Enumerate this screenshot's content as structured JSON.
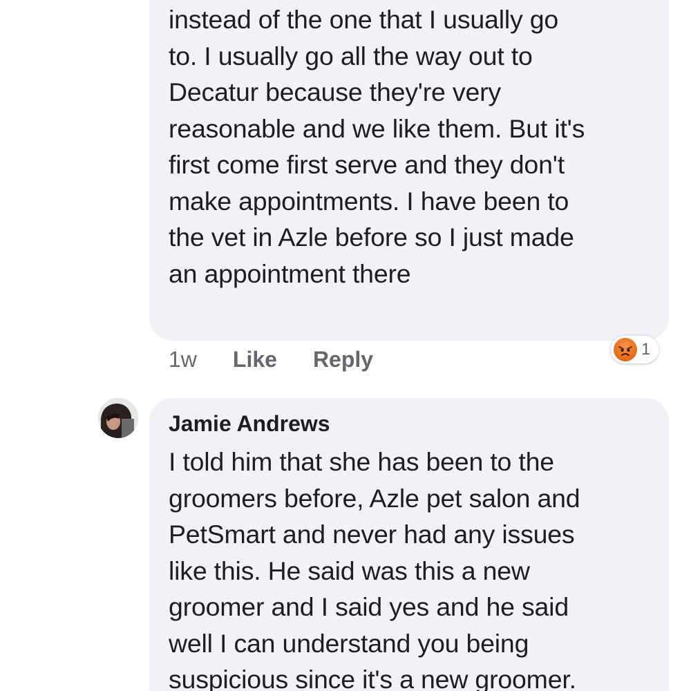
{
  "comment1": {
    "lines": [
      "instead of the one that I usually go",
      "to. I usually go all the way out to",
      "Decatur because they're very",
      "reasonable and we like them. But it's",
      "first come first serve and they don't",
      "make appointments. I have been to",
      "the vet in Azle before so I just made",
      "an appointment there"
    ],
    "time": "1w",
    "like_label": "Like",
    "reply_label": "Reply",
    "reaction": {
      "icon": "angry-reaction-icon",
      "count": "1",
      "color": "#e9711c"
    }
  },
  "comment2": {
    "author": "Jamie Andrews",
    "lines": [
      "I told him that she has been to the",
      "groomers before, Azle pet salon and",
      "PetSmart and never had any issues",
      "like this. He said was this a new",
      "groomer and I said yes and he said",
      "well I can understand you being",
      "suspicious since it's a new groomer."
    ]
  },
  "colors": {
    "bubble": "#f0f2f5",
    "text": "#1c1e21",
    "secondary": "#65676b",
    "reaction_angry": "#e9711c"
  }
}
